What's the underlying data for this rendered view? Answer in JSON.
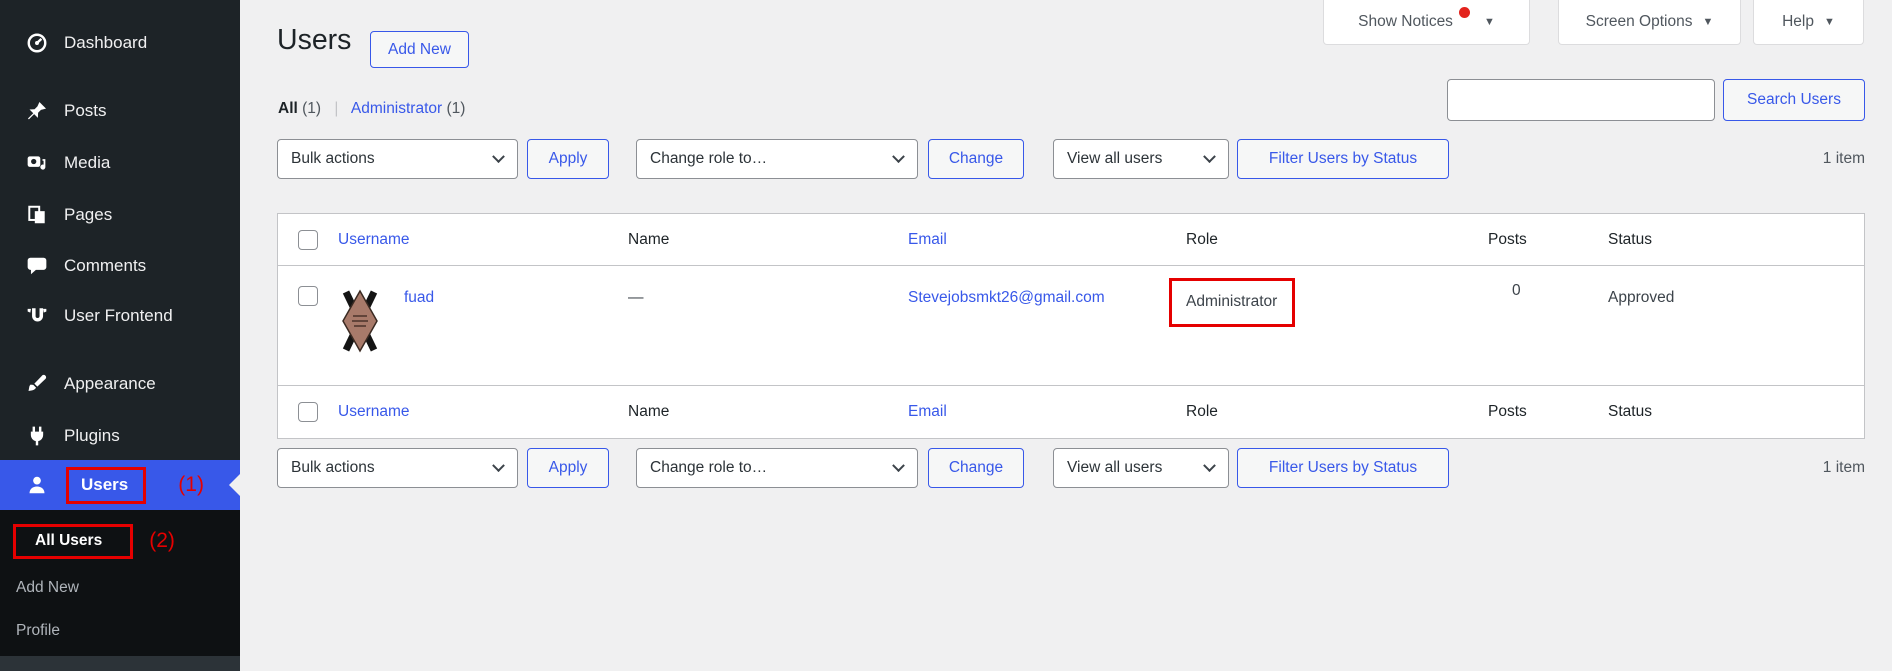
{
  "colors": {
    "accent_blue": "#3858e9",
    "annotation_red": "#e50000",
    "sidebar_bg": "#1d2327",
    "submenu_bg": "#0e1113",
    "active_menu_bg": "#3858e9",
    "content_bg": "#f0f0f1",
    "table_border": "#c3c4c7",
    "text_dark": "#2c3338",
    "text_muted": "#50575e",
    "notice_dot_red": "#e3231d"
  },
  "sidebar": {
    "items": [
      {
        "label": "Dashboard",
        "icon": "dashboard-icon"
      },
      {
        "label": "Posts",
        "icon": "pushpin-icon"
      },
      {
        "label": "Media",
        "icon": "media-icon"
      },
      {
        "label": "Pages",
        "icon": "pages-icon"
      },
      {
        "label": "Comments",
        "icon": "comment-bubble-icon"
      },
      {
        "label": "User Frontend",
        "icon": "user-frontend-icon"
      },
      {
        "label": "Appearance",
        "icon": "paintbrush-icon"
      },
      {
        "label": "Plugins",
        "icon": "plug-icon"
      },
      {
        "label": "Users",
        "icon": "users-icon",
        "active": true,
        "annotation": "(1)"
      }
    ],
    "submenu": [
      {
        "label": "All Users",
        "current": true,
        "annotation": "(2)"
      },
      {
        "label": "Add New"
      },
      {
        "label": "Profile"
      }
    ]
  },
  "screen_meta": {
    "show_notices": "Show Notices",
    "screen_options": "Screen Options",
    "help": "Help",
    "caret": "▼"
  },
  "page_header": {
    "title": "Users",
    "add_new": "Add New"
  },
  "views": {
    "all": "All",
    "all_count": "(1)",
    "separator": "|",
    "administrator": "Administrator",
    "administrator_count": "(1)"
  },
  "toolbar": {
    "bulk_actions": "Bulk actions",
    "apply": "Apply",
    "change_role": "Change role to…",
    "change": "Change",
    "view_all_users": "View all users",
    "filter_by_status": "Filter Users by Status",
    "item_count": "1 item"
  },
  "search": {
    "value": "",
    "button": "Search Users"
  },
  "table": {
    "columns": [
      "Username",
      "Name",
      "Email",
      "Role",
      "Posts",
      "Status"
    ],
    "rows": [
      {
        "username": "fuad",
        "name": "—",
        "email": "Stevejobsmkt26@gmail.com",
        "role": "Administrator",
        "posts": "0",
        "status": "Approved"
      }
    ]
  }
}
